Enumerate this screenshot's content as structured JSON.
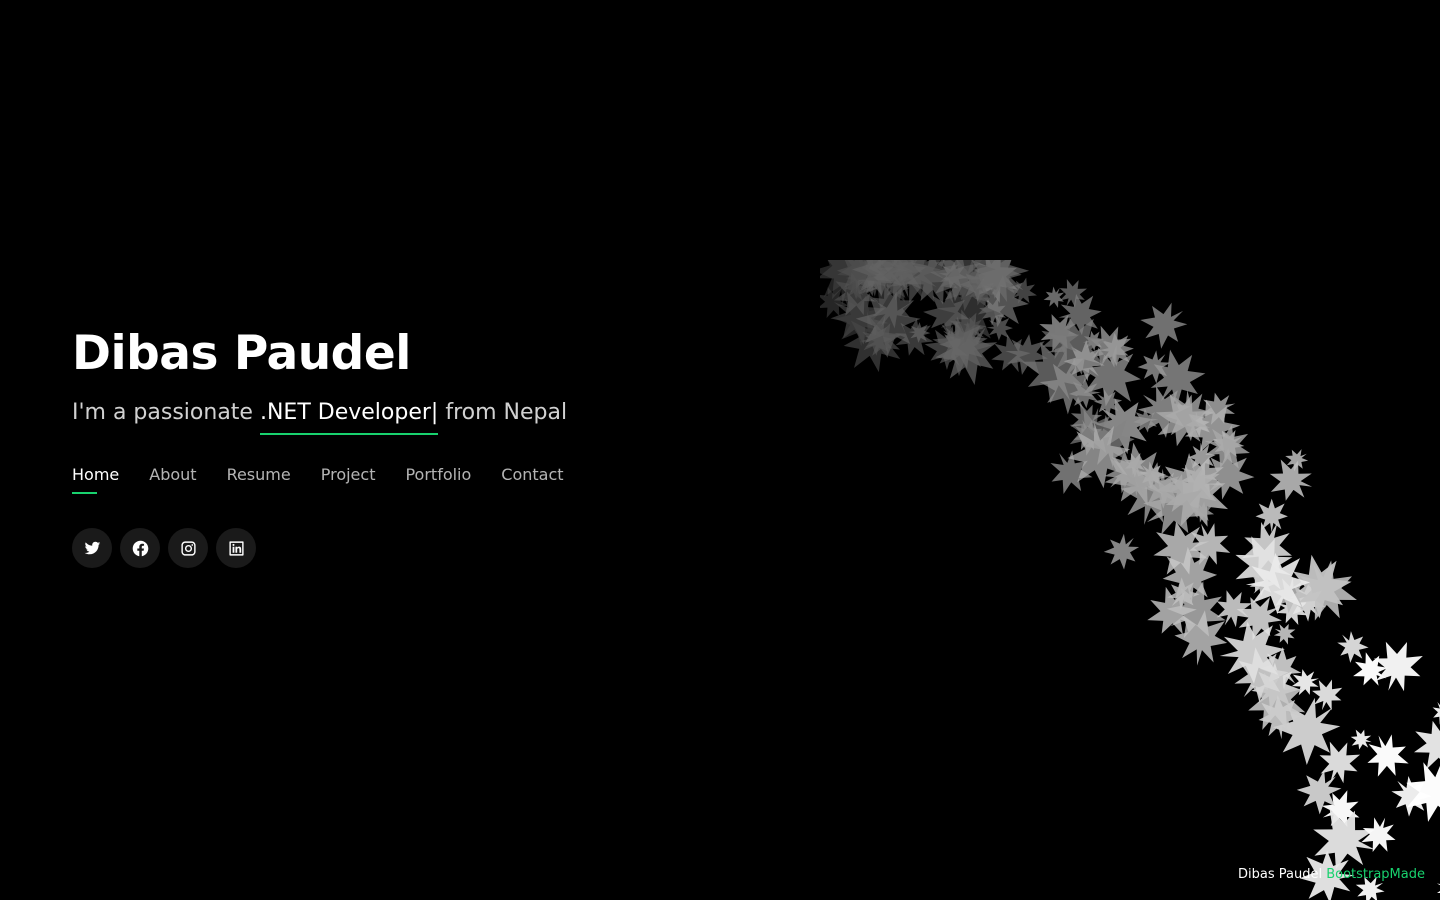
{
  "hero": {
    "name": "Dibas Paudel",
    "subtitle_prefix": "I'm a passionate ",
    "subtitle_typed": ".NET Developer",
    "subtitle_cursor": "|",
    "subtitle_suffix": " from Nepal"
  },
  "nav": {
    "items": [
      {
        "label": "Home",
        "active": true
      },
      {
        "label": "About",
        "active": false
      },
      {
        "label": "Resume",
        "active": false
      },
      {
        "label": "Project",
        "active": false
      },
      {
        "label": "Portfolio",
        "active": false
      },
      {
        "label": "Contact",
        "active": false
      }
    ]
  },
  "social": {
    "icons": [
      "twitter-icon",
      "facebook-icon",
      "instagram-icon",
      "linkedin-icon"
    ]
  },
  "credits": {
    "owner": "Dibas Paudel",
    "link": "BootstrapMade"
  },
  "colors": {
    "background": "#000000",
    "accent": "#18d26e",
    "text": "#ffffff"
  }
}
